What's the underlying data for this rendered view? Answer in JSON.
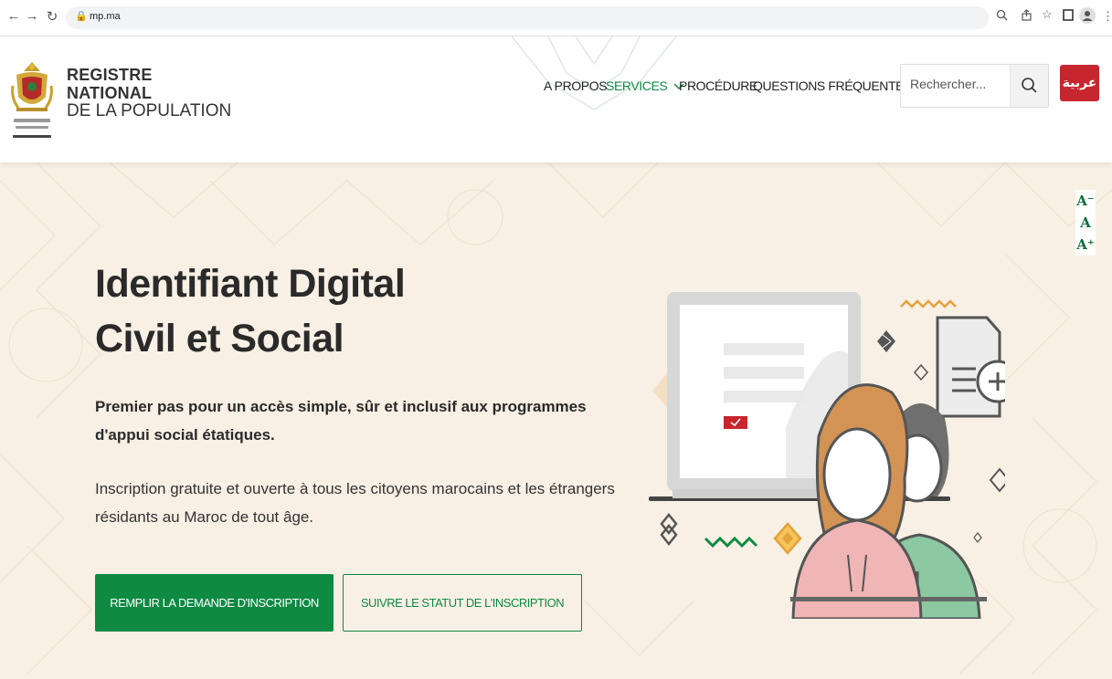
{
  "browser": {
    "url": "mp.ma"
  },
  "header": {
    "brand_line1": "REGISTRE",
    "brand_line2": "NATIONAL",
    "brand_line3": "DE LA POPULATION",
    "nav": {
      "about": "A PROPOS",
      "services": "SERVICES",
      "procedure": "PROCÉDURE",
      "faq": "QUESTIONS FRÉQUENTES"
    },
    "search_placeholder": "Rechercher...",
    "arabic_label": "عربية"
  },
  "hero": {
    "title_line1": "Identifiant Digital",
    "title_line2": "Civil et Social",
    "subtitle": "Premier pas pour un accès simple, sûr et inclusif aux programmes d'appui social étatiques.",
    "description": "Inscription gratuite et ouverte à tous les citoyens marocains et les étrangers résidants au Maroc de tout âge.",
    "primary_button": "REMPLIR LA DEMANDE D'INSCRIPTION",
    "secondary_button": "SUIVRE LE STATUT DE L'INSCRIPTION"
  },
  "font_controls": {
    "decrease": "A⁻",
    "normal": "A",
    "increase": "A⁺"
  },
  "colors": {
    "brand_green": "#0e8a43",
    "arabic_red": "#c8262f",
    "hero_bg": "#f8f0e5"
  }
}
